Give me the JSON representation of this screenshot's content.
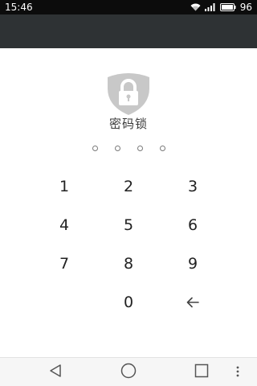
{
  "status_bar": {
    "time": "15:46",
    "battery_level": "96",
    "icons": [
      "wifi-icon",
      "signal-icon",
      "battery-icon"
    ]
  },
  "lock": {
    "title": "密码锁",
    "pin_length": 4,
    "pin_entered": 0,
    "icon": "shield-lock-icon"
  },
  "keypad": {
    "keys": [
      "1",
      "2",
      "3",
      "4",
      "5",
      "6",
      "7",
      "8",
      "9",
      "0"
    ],
    "backspace_icon": "backspace-arrow-icon"
  },
  "nav_bar": {
    "buttons": [
      "back-triangle-icon",
      "home-circle-icon",
      "recents-square-icon",
      "menu-dots-icon"
    ]
  },
  "colors": {
    "status_bar": "#0c0c0c",
    "app_bar": "#2e3234",
    "background": "#ffffff",
    "shield": "#c8c8c8",
    "text": "#222222"
  }
}
